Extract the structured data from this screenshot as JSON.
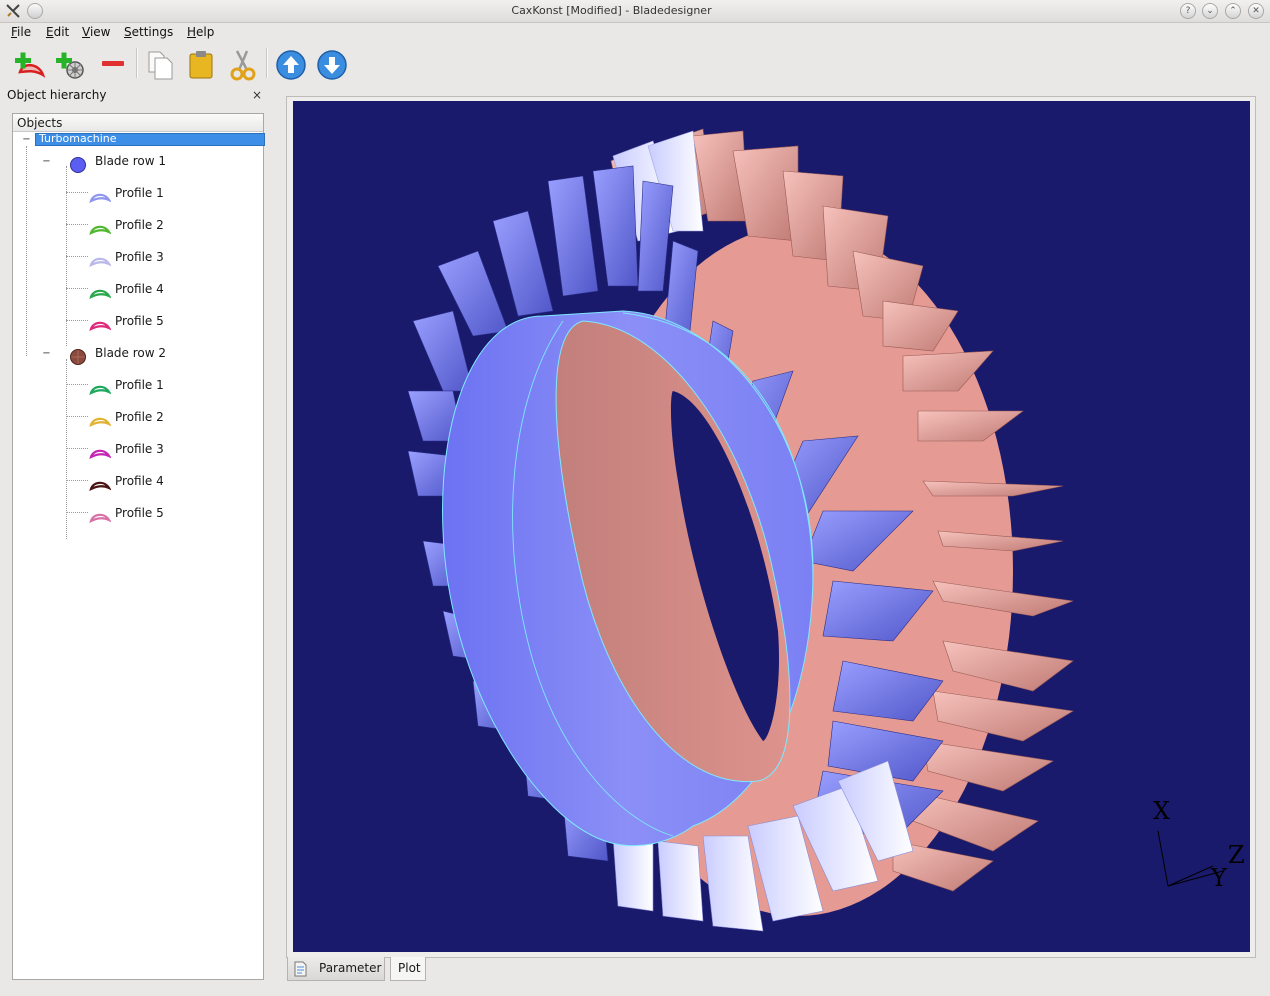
{
  "window": {
    "title": "CaxKonst [Modified] - Bladedesigner",
    "buttons": [
      "?",
      "⌄",
      "⌃",
      "✕"
    ]
  },
  "menubar": {
    "items": [
      {
        "accel": "F",
        "rest": "ile"
      },
      {
        "accel": "E",
        "rest": "dit"
      },
      {
        "accel": "V",
        "rest": "iew"
      },
      {
        "accel": "S",
        "rest": "ettings"
      },
      {
        "accel": "H",
        "rest": "elp"
      }
    ]
  },
  "toolbar": {
    "icons": [
      "add-profile-icon",
      "add-blade-row-icon",
      "remove-icon",
      "copy-icon",
      "paste-icon",
      "cut-icon",
      "move-up-icon",
      "move-down-icon"
    ]
  },
  "dock": {
    "title": "Object hierarchy",
    "close": "×",
    "header": "Objects",
    "root": {
      "label": "Turbomachine",
      "expander": "−"
    },
    "blade_rows": [
      {
        "label": "Blade row 1",
        "expander": "−",
        "color": "#5b5ef0",
        "profiles": [
          {
            "label": "Profile 1",
            "color": "#8f96ee"
          },
          {
            "label": "Profile 2",
            "color": "#4fb82e"
          },
          {
            "label": "Profile 3",
            "color": "#b9b8e8"
          },
          {
            "label": "Profile 4",
            "color": "#28a84a"
          },
          {
            "label": "Profile 5",
            "color": "#e0287a"
          }
        ]
      },
      {
        "label": "Blade row 2",
        "expander": "−",
        "color": "#8a4a3e",
        "profiles": [
          {
            "label": "Profile 1",
            "color": "#1ea85e"
          },
          {
            "label": "Profile 2",
            "color": "#e2b232"
          },
          {
            "label": "Profile 3",
            "color": "#c624b4"
          },
          {
            "label": "Profile 4",
            "color": "#4a1414"
          },
          {
            "label": "Profile 5",
            "color": "#d872a6"
          }
        ]
      }
    ]
  },
  "plot": {
    "background": "#1a1a6c",
    "axes": {
      "x": "X",
      "y": "Y",
      "z": "Z"
    }
  },
  "tabs": [
    {
      "label": "Parameter",
      "active": false
    },
    {
      "label": "Plot",
      "active": true
    }
  ]
}
